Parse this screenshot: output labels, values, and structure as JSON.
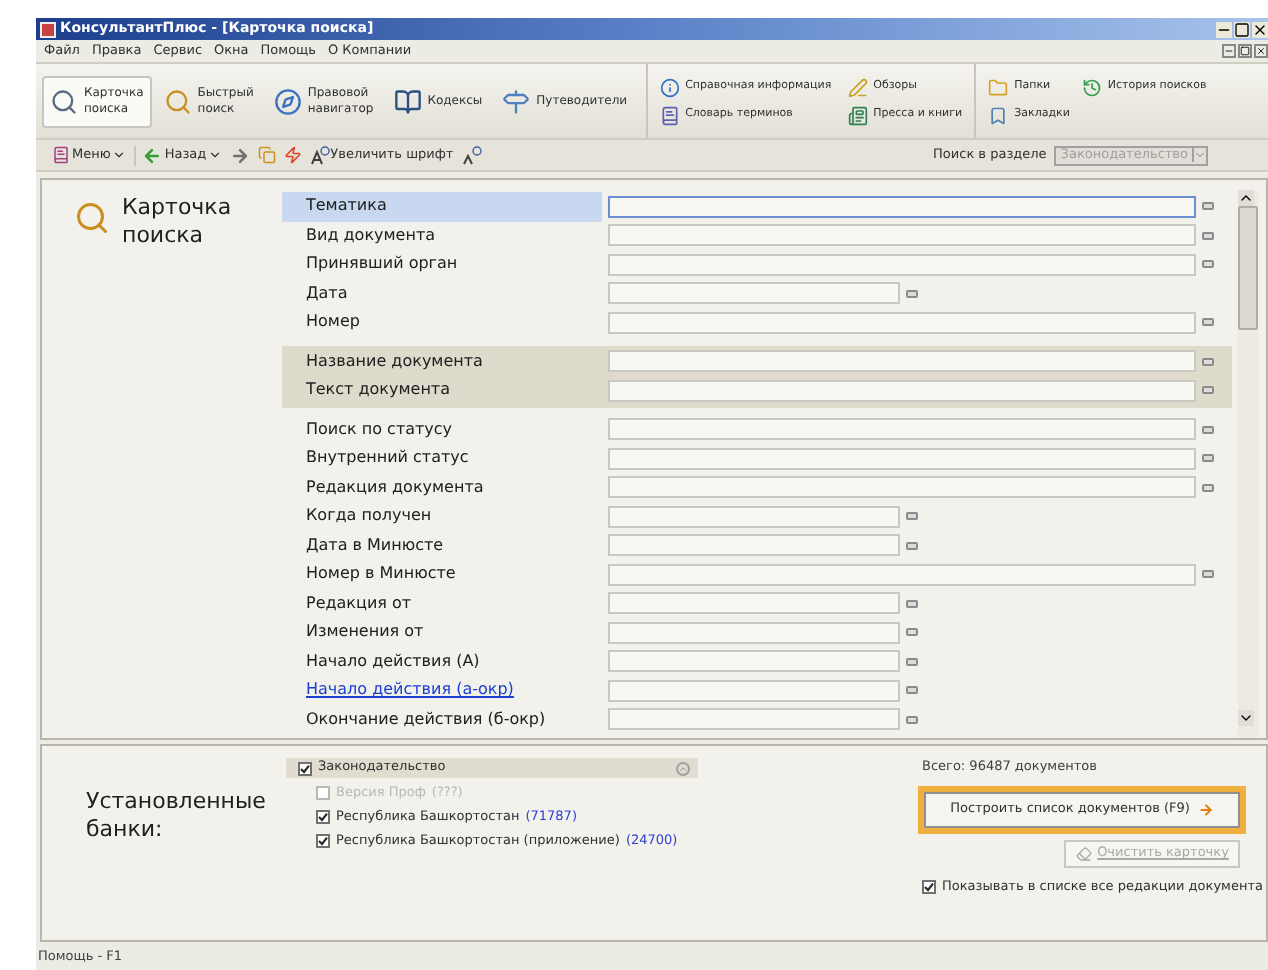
{
  "window": {
    "title": "КонсультантПлюс - [Карточка поиска]"
  },
  "menu": [
    "Файл",
    "Правка",
    "Сервис",
    "Окна",
    "Помощь",
    "О Компании"
  ],
  "toolbar": {
    "main": [
      {
        "label": "Карточка\nпоиска",
        "selected": true
      },
      {
        "label": "Быстрый\nпоиск",
        "selected": false
      },
      {
        "label": "Правовой\nнавигатор",
        "selected": false
      },
      {
        "label": "Кодексы",
        "selected": false
      },
      {
        "label": "Путеводители",
        "selected": false
      }
    ],
    "info": [
      "Справочная информация",
      "Обзоры",
      "Словарь терминов",
      "Пресса и книги"
    ],
    "personal": [
      "Папки",
      "История поисков",
      "Закладки"
    ]
  },
  "nav": {
    "menu": "Меню",
    "back": "Назад",
    "font": "Увеличить шрифт",
    "section_label": "Поиск в разделе",
    "section_value": "Законодательство"
  },
  "card": {
    "title": "Карточка\nпоиска",
    "groups": [
      {
        "highlighted": false,
        "rows": [
          {
            "label": "Тематика",
            "kind": "text",
            "selected": true,
            "link": false
          },
          {
            "label": "Вид документа",
            "kind": "text",
            "selected": false,
            "link": false
          },
          {
            "label": "Принявший орган",
            "kind": "text",
            "selected": false,
            "link": false
          },
          {
            "label": "Дата",
            "kind": "date",
            "selected": false,
            "link": false
          },
          {
            "label": "Номер",
            "kind": "text",
            "selected": false,
            "link": false
          }
        ]
      },
      {
        "highlighted": true,
        "rows": [
          {
            "label": "Название документа",
            "kind": "text",
            "selected": false,
            "link": false
          },
          {
            "label": "Текст документа",
            "kind": "text",
            "selected": false,
            "link": false
          }
        ]
      },
      {
        "highlighted": false,
        "rows": [
          {
            "label": "Поиск по статусу",
            "kind": "text",
            "selected": false,
            "link": false
          },
          {
            "label": "Внутренний статус",
            "kind": "text",
            "selected": false,
            "link": false
          },
          {
            "label": "Редакция документа",
            "kind": "text",
            "selected": false,
            "link": false
          },
          {
            "label": "Когда получен",
            "kind": "date",
            "selected": false,
            "link": false
          },
          {
            "label": "Дата в Минюсте",
            "kind": "date",
            "selected": false,
            "link": false
          },
          {
            "label": "Номер в Минюсте",
            "kind": "text",
            "selected": false,
            "link": false
          },
          {
            "label": "Редакция от",
            "kind": "date",
            "selected": false,
            "link": false
          },
          {
            "label": "Изменения от",
            "kind": "date",
            "selected": false,
            "link": false
          },
          {
            "label": "Начало действия (А)",
            "kind": "date",
            "selected": false,
            "link": false
          },
          {
            "label": "Начало действия (а-окр)",
            "kind": "date",
            "selected": false,
            "link": true
          },
          {
            "label": "Окончание действия (б-окр)",
            "kind": "date",
            "selected": false,
            "link": false
          }
        ]
      }
    ]
  },
  "banks": {
    "title": "Установленные\nбанки:",
    "group": {
      "label": "Законодательство",
      "checked": true
    },
    "items": [
      {
        "label": "Версия Проф",
        "count": "(???)",
        "checked": false,
        "disabled": true
      },
      {
        "label": "Республика Башкортостан",
        "count": "(71787)",
        "checked": true,
        "disabled": false
      },
      {
        "label": "Республика Башкортостан (приложение)",
        "count": "(24700)",
        "checked": true,
        "disabled": false
      }
    ]
  },
  "total": "Всего: 96487 документов",
  "build_button": {
    "label": "Построить список документов (F9)",
    "focused": true
  },
  "clear_button": {
    "label": "Очистить карточку",
    "disabled": true
  },
  "show_all": {
    "label": "Показывать в списке все редакции документа",
    "checked": true
  },
  "status_bar": "Помощь - F1"
}
